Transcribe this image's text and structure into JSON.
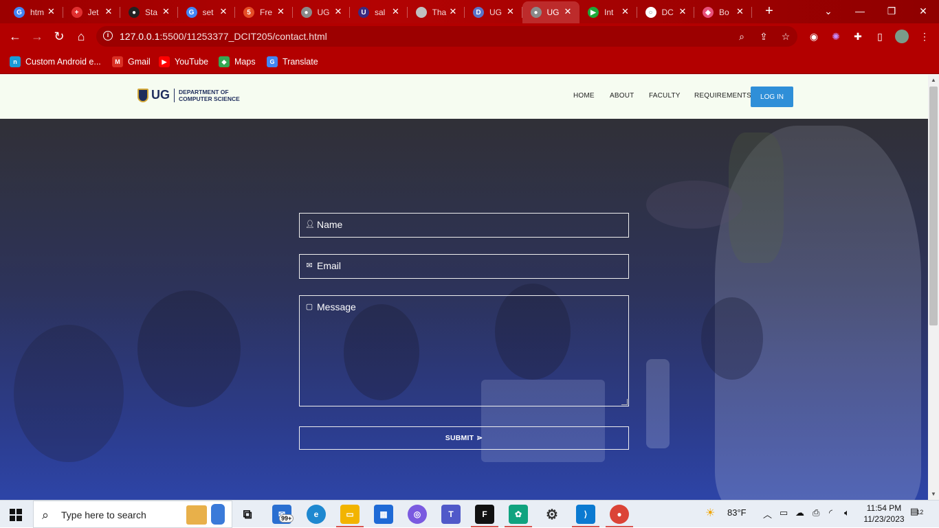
{
  "browser": {
    "tabs": [
      {
        "label": "htm",
        "favicon": "google-icon",
        "color": "#4285f4",
        "glyph": "G"
      },
      {
        "label": "Jet",
        "favicon": "swiss-flag-icon",
        "color": "#e03030",
        "glyph": "+"
      },
      {
        "label": "Sta",
        "favicon": "github-icon",
        "color": "#222222",
        "glyph": "●"
      },
      {
        "label": "set",
        "favicon": "google-icon",
        "color": "#4285f4",
        "glyph": "G"
      },
      {
        "label": "Fre",
        "favicon": "html5-icon",
        "color": "#e44d26",
        "glyph": "5"
      },
      {
        "label": "UG",
        "favicon": "globe-icon",
        "color": "#8a8a8a",
        "glyph": "●"
      },
      {
        "label": "sal",
        "favicon": "ug-crest-icon",
        "color": "#3a2a80",
        "glyph": "U"
      },
      {
        "label": "Tha",
        "favicon": "blank-icon",
        "color": "#c0c0c0",
        "glyph": ""
      },
      {
        "label": "UG",
        "favicon": "dcs-icon",
        "color": "#5a73c8",
        "glyph": "D"
      },
      {
        "label": "UG",
        "favicon": "globe-icon",
        "color": "#8a8a8a",
        "glyph": "●",
        "active": true
      },
      {
        "label": "Int",
        "favicon": "play-icon",
        "color": "#1fa83a",
        "glyph": "▶"
      },
      {
        "label": "DC",
        "favicon": "github-icon",
        "color": "#ffffff",
        "glyph": "○"
      },
      {
        "label": "Bo",
        "favicon": "cube-icon",
        "color": "#e8507a",
        "glyph": "◆"
      }
    ],
    "new_tab": "+",
    "window_controls": {
      "tab_search": "⌄",
      "minimize": "—",
      "restore": "❐",
      "close": "✕"
    },
    "url_host": "127.0.0.1",
    "url_path": ":5500/11253377_DCIT205/contact.html",
    "bookmarks": [
      {
        "label": "Custom Android e...",
        "icon": "nox-icon",
        "color": "#1a9bd7",
        "glyph": "n"
      },
      {
        "label": "Gmail",
        "icon": "gmail-icon",
        "color": "#d93025",
        "glyph": "M"
      },
      {
        "label": "YouTube",
        "icon": "youtube-icon",
        "color": "#ff0000",
        "glyph": "▶"
      },
      {
        "label": "Maps",
        "icon": "maps-icon",
        "color": "#34a853",
        "glyph": "◆"
      },
      {
        "label": "Translate",
        "icon": "translate-icon",
        "color": "#4285f4",
        "glyph": "G"
      }
    ]
  },
  "site": {
    "logo": {
      "ug": "UG",
      "line1": "DEPARTMENT OF",
      "line2": "COMPUTER SCIENCE"
    },
    "nav": {
      "home": "HOME",
      "about": "ABOUT",
      "faculty": "FACULTY",
      "requirements": "REQUIREMENTS",
      "login": "LOG IN"
    },
    "form": {
      "name_label": "Name",
      "email_label": "Email",
      "message_label": "Message",
      "submit_label": "SUBMIT",
      "submit_icon": "⋗"
    }
  },
  "taskbar": {
    "search_placeholder": "Type here to search",
    "mail_badge": "99+",
    "weather": "83°F",
    "time": "11:54 PM",
    "date": "11/23/2023",
    "notification_count": "12"
  }
}
